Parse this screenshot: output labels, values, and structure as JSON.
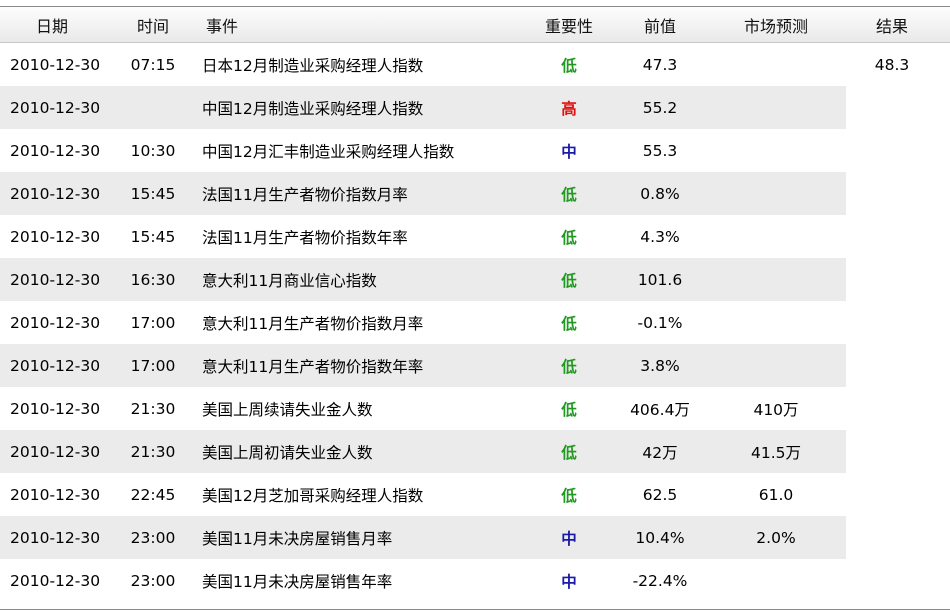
{
  "headers": {
    "date": "日期",
    "time": "时间",
    "event": "事件",
    "importance": "重要性",
    "previous": "前值",
    "forecast": "市场预测",
    "result": "结果"
  },
  "importance_colors": {
    "低": "#1f9a1f",
    "高": "#e01010",
    "中": "#1a1aa8"
  },
  "rows": [
    {
      "date": "2010-12-30",
      "time": "07:15",
      "event": "日本12月制造业采购经理人指数",
      "importance": "低",
      "previous": "47.3",
      "forecast": "",
      "result": "48.3"
    },
    {
      "date": "2010-12-30",
      "time": "",
      "event": "中国12月制造业采购经理人指数",
      "importance": "高",
      "previous": "55.2",
      "forecast": "",
      "result": ""
    },
    {
      "date": "2010-12-30",
      "time": "10:30",
      "event": "中国12月汇丰制造业采购经理人指数",
      "importance": "中",
      "previous": "55.3",
      "forecast": "",
      "result": ""
    },
    {
      "date": "2010-12-30",
      "time": "15:45",
      "event": "法国11月生产者物价指数月率",
      "importance": "低",
      "previous": "0.8%",
      "forecast": "",
      "result": ""
    },
    {
      "date": "2010-12-30",
      "time": "15:45",
      "event": "法国11月生产者物价指数年率",
      "importance": "低",
      "previous": "4.3%",
      "forecast": "",
      "result": ""
    },
    {
      "date": "2010-12-30",
      "time": "16:30",
      "event": "意大利11月商业信心指数",
      "importance": "低",
      "previous": "101.6",
      "forecast": "",
      "result": ""
    },
    {
      "date": "2010-12-30",
      "time": "17:00",
      "event": "意大利11月生产者物价指数月率",
      "importance": "低",
      "previous": "-0.1%",
      "forecast": "",
      "result": ""
    },
    {
      "date": "2010-12-30",
      "time": "17:00",
      "event": "意大利11月生产者物价指数年率",
      "importance": "低",
      "previous": "3.8%",
      "forecast": "",
      "result": ""
    },
    {
      "date": "2010-12-30",
      "time": "21:30",
      "event": "美国上周续请失业金人数",
      "importance": "低",
      "previous": "406.4万",
      "forecast": "410万",
      "result": ""
    },
    {
      "date": "2010-12-30",
      "time": "21:30",
      "event": "美国上周初请失业金人数",
      "importance": "低",
      "previous": "42万",
      "forecast": "41.5万",
      "result": ""
    },
    {
      "date": "2010-12-30",
      "time": "22:45",
      "event": "美国12月芝加哥采购经理人指数",
      "importance": "低",
      "previous": "62.5",
      "forecast": "61.0",
      "result": ""
    },
    {
      "date": "2010-12-30",
      "time": "23:00",
      "event": "美国11月未决房屋销售月率",
      "importance": "中",
      "previous": "10.4%",
      "forecast": "2.0%",
      "result": ""
    },
    {
      "date": "2010-12-30",
      "time": "23:00",
      "event": "美国11月未决房屋销售年率",
      "importance": "中",
      "previous": "-22.4%",
      "forecast": "",
      "result": ""
    }
  ]
}
